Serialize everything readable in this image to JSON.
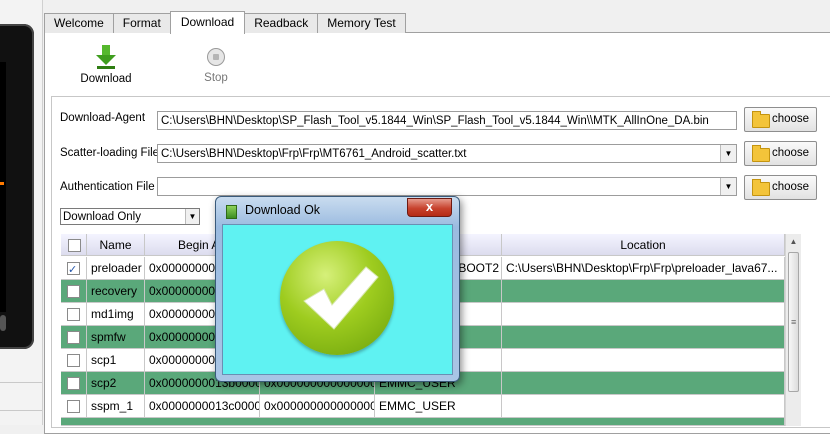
{
  "tabs": [
    {
      "label": "Welcome"
    },
    {
      "label": "Format"
    },
    {
      "label": "Download"
    },
    {
      "label": "Readback"
    },
    {
      "label": "Memory Test"
    }
  ],
  "active_tab": "Download",
  "toolbar": {
    "download_label": "Download",
    "stop_label": "Stop"
  },
  "fields": {
    "download_agent": {
      "label": "Download-Agent",
      "value": "C:\\Users\\BHN\\Desktop\\SP_Flash_Tool_v5.1844_Win\\SP_Flash_Tool_v5.1844_Win\\\\MTK_AllInOne_DA.bin"
    },
    "scatter": {
      "label": "Scatter-loading File",
      "value": "C:\\Users\\BHN\\Desktop\\Frp\\Frp\\MT6761_Android_scatter.txt"
    },
    "auth": {
      "label": "Authentication File",
      "value": ""
    },
    "choose_label": "choose"
  },
  "mode": {
    "selected": "Download Only"
  },
  "table": {
    "headers": [
      "Name",
      "Begin Ad",
      "",
      "",
      "Location"
    ],
    "rows": [
      {
        "checked": true,
        "name": "preloader",
        "begin": "0x000000000",
        "end": "",
        "region": "BOOT2",
        "location": "C:\\Users\\BHN\\Desktop\\Frp\\Frp\\preloader_lava67..."
      },
      {
        "checked": false,
        "name": "recovery",
        "begin": "0x000000000",
        "end": "",
        "region": "",
        "location": ""
      },
      {
        "checked": false,
        "name": "md1img",
        "begin": "0x000000000",
        "end": "",
        "region": "",
        "location": ""
      },
      {
        "checked": false,
        "name": "spmfw",
        "begin": "0x000000001",
        "end": "",
        "region": "",
        "location": ""
      },
      {
        "checked": false,
        "name": "scp1",
        "begin": "0x000000001",
        "end": "",
        "region": "",
        "location": ""
      },
      {
        "checked": false,
        "name": "scp2",
        "begin": "0x0000000013b00000",
        "end": "0x0000000000000000",
        "region": "EMMC_USER",
        "location": ""
      },
      {
        "checked": false,
        "name": "sspm_1",
        "begin": "0x0000000013c00000",
        "end": "0x0000000000000000",
        "region": "EMMC_USER",
        "location": ""
      }
    ]
  },
  "dialog": {
    "title": "Download Ok",
    "close_glyph": "x"
  },
  "colors": {
    "row_green": "#5aa87a",
    "dialog_body": "#5ff2f2",
    "check_green": "#9ecc1f"
  }
}
